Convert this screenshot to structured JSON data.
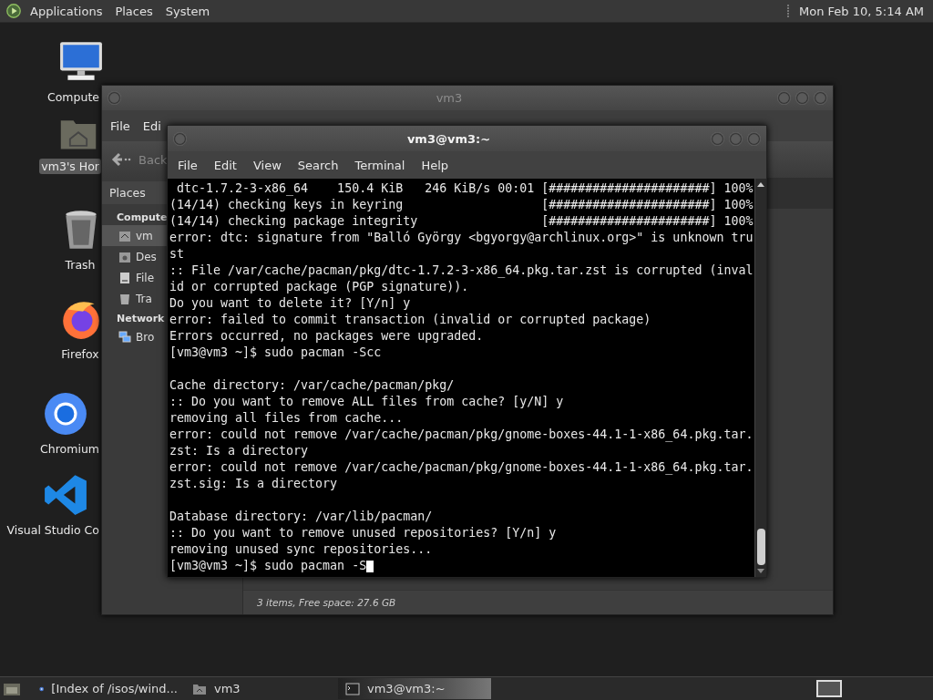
{
  "top_panel": {
    "menus": [
      "Applications",
      "Places",
      "System"
    ],
    "clock": "Mon Feb 10,  5:14 AM"
  },
  "desktop_icons": [
    {
      "kind": "computer",
      "label": "Compute",
      "selected": false
    },
    {
      "kind": "home",
      "label": "vm3's Hor",
      "selected": true
    },
    {
      "kind": "trash",
      "label": "Trash",
      "selected": false
    },
    {
      "kind": "firefox",
      "label": "Firefox",
      "selected": false
    },
    {
      "kind": "chromium",
      "label": "Chromium",
      "selected": false
    },
    {
      "kind": "vscode",
      "label": "Visual Studio Co",
      "selected": false
    }
  ],
  "file_manager": {
    "title": "vm3",
    "menu": [
      "File",
      "Edi"
    ],
    "back": "Back",
    "sidebar": {
      "header": "Places",
      "sections": [
        {
          "title": "Compute",
          "items": [
            {
              "kind": "home",
              "label": "vm",
              "selected": true
            },
            {
              "kind": "desktop",
              "label": "Des",
              "selected": false
            },
            {
              "kind": "disk",
              "label": "File",
              "selected": false
            },
            {
              "kind": "trash",
              "label": "Tra",
              "selected": false
            }
          ]
        },
        {
          "title": "Network",
          "items": [
            {
              "kind": "network",
              "label": "Bro",
              "selected": false
            }
          ]
        }
      ]
    },
    "status": "3 items, Free space: 27.6 GB"
  },
  "terminal": {
    "title": "vm3@vm3:~",
    "menu": [
      "File",
      "Edit",
      "View",
      "Search",
      "Terminal",
      "Help"
    ],
    "blocks": [
      [
        " dtc-1.7.2-3-x86_64    150.4 KiB   246 KiB/s 00:01 [######################] 100%",
        "(14/14) checking keys in keyring                   [######################] 100%",
        "(14/14) checking package integrity                 [######################] 100%",
        "error: dtc: signature from \"Balló György <bgyorgy@archlinux.org>\" is unknown tru",
        "st",
        ":: File /var/cache/pacman/pkg/dtc-1.7.2-3-x86_64.pkg.tar.zst is corrupted (inval",
        "id or corrupted package (PGP signature)).",
        "Do you want to delete it? [Y/n] y",
        "error: failed to commit transaction (invalid or corrupted package)",
        "Errors occurred, no packages were upgraded.",
        "[vm3@vm3 ~]$ sudo pacman -Scc"
      ],
      [
        "Cache directory: /var/cache/pacman/pkg/",
        ":: Do you want to remove ALL files from cache? [y/N] y",
        "removing all files from cache...",
        "error: could not remove /var/cache/pacman/pkg/gnome-boxes-44.1-1-x86_64.pkg.tar.",
        "zst: Is a directory",
        "error: could not remove /var/cache/pacman/pkg/gnome-boxes-44.1-1-x86_64.pkg.tar.",
        "zst.sig: Is a directory"
      ],
      [
        "Database directory: /var/lib/pacman/",
        ":: Do you want to remove unused repositories? [Y/n] y",
        "removing unused sync repositories...",
        "[vm3@vm3 ~]$ sudo pacman -S"
      ]
    ]
  },
  "taskbar": {
    "items": [
      {
        "kind": "browser",
        "label": "[Index of /isos/wind...",
        "selected": false
      },
      {
        "kind": "folder",
        "label": "vm3",
        "selected": false
      },
      {
        "kind": "terminal",
        "label": "vm3@vm3:~",
        "selected": true
      }
    ]
  }
}
